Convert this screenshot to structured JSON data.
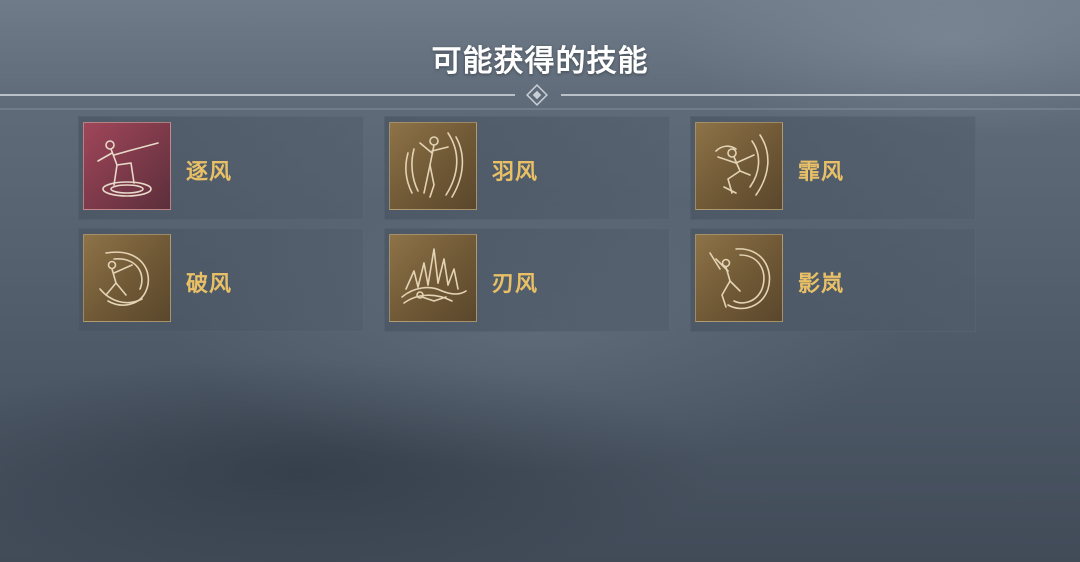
{
  "title": "可能获得的技能",
  "skills": [
    {
      "name": "逐风",
      "icon": "figure-on-ring-icon",
      "accent": "red"
    },
    {
      "name": "羽风",
      "icon": "archer-drawing-bow-icon",
      "accent": "bronze"
    },
    {
      "name": "霏风",
      "icon": "crouching-leaper-icon",
      "accent": "bronze"
    },
    {
      "name": "破风",
      "icon": "bow-swirl-icon",
      "accent": "bronze"
    },
    {
      "name": "刃风",
      "icon": "blade-spikes-icon",
      "accent": "bronze"
    },
    {
      "name": "影岚",
      "icon": "crescent-figure-icon",
      "accent": "bronze"
    }
  ],
  "colors": {
    "label_gold": "#e9c066",
    "title_white": "#ffffff",
    "frame_bronze": "#8e7348",
    "frame_red": "#a0465a"
  }
}
